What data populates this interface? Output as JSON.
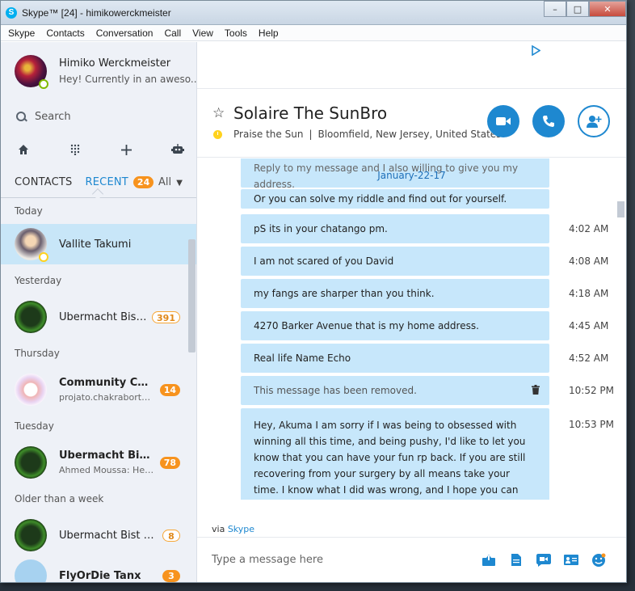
{
  "window": {
    "title": "Skype™ [24] - himikowerckmeister",
    "app_logo": "S",
    "buttons": {
      "minimize": "–",
      "maximize": "□",
      "close": "✕"
    }
  },
  "menu": [
    "Skype",
    "Contacts",
    "Conversation",
    "Call",
    "View",
    "Tools",
    "Help"
  ],
  "profile": {
    "name": "Himiko Werckmeister",
    "mood": "Hey! Currently in an aweso..."
  },
  "search": {
    "placeholder": "Search"
  },
  "toolbar_icons": [
    "home-icon",
    "dialpad-icon",
    "plus-icon",
    "bot-icon"
  ],
  "tabs": {
    "contacts": "CONTACTS",
    "recent": "RECENT",
    "recent_count": "24",
    "filter": "All"
  },
  "sections": [
    {
      "header": "Today",
      "items": [
        {
          "name": "Vallite Takumi",
          "preview": "",
          "badge": "",
          "bold": false,
          "selected": true,
          "avatar": "anime",
          "status": "away"
        }
      ]
    },
    {
      "header": "Yesterday",
      "items": [
        {
          "name": "Übermacht Bist R...",
          "preview": "",
          "badge": "391",
          "badge_style": "outline",
          "bold": false,
          "avatar": "eagle"
        }
      ]
    },
    {
      "header": "Thursday",
      "items": [
        {
          "name": "Community Chat...",
          "preview": "projato.chakraborty:...",
          "badge": "14",
          "bold": true,
          "avatar": "community"
        }
      ]
    },
    {
      "header": "Tuesday",
      "items": [
        {
          "name": "Übermacht Bist...",
          "preview": "Ahmed Moussa: Hel...",
          "badge": "78",
          "bold": true,
          "avatar": "eagle"
        }
      ]
    },
    {
      "header": "Older than a week",
      "items": [
        {
          "name": "Übermacht Bist Rein",
          "preview": "",
          "badge": "8",
          "badge_style": "outline",
          "bold": false,
          "avatar": "eagle"
        },
        {
          "name": "FlyOrDie Tanx",
          "preview": "",
          "badge": "3",
          "bold": true,
          "avatar": "group"
        }
      ]
    }
  ],
  "conversation": {
    "contact_name": "Solaire The SunBro",
    "mood": "Praise the Sun",
    "location": "Bloomfield, New Jersey, United States",
    "date_chip": "January-22-17",
    "faded_text": "Reply to my message and I also willing to give you my address.",
    "messages": [
      {
        "text": "Or you can solve my riddle and find out for yourself.",
        "time": ""
      },
      {
        "text": "pS its in your chatango pm.",
        "time": "4:02 AM"
      },
      {
        "text": "I am not scared of you David",
        "time": "4:08 AM"
      },
      {
        "text": "my fangs are sharper than you think.",
        "time": "4:18 AM"
      },
      {
        "text": "4270 Barker Avenue that is my home address.",
        "time": "4:45 AM"
      },
      {
        "text": "Real life Name Echo",
        "time": "4:52 AM"
      },
      {
        "text": "This message has been removed.",
        "time": "10:52 PM"
      },
      {
        "text": "Hey, Akuma I am sorry if I was being to obsessed with winning all this time, and being pushy, I'd like to let you know that you can have your fun rp back. If you are still recovering from your surgery by all means take your time. I know what I did was wrong, and I hope you can",
        "time": "10:53 PM"
      }
    ],
    "via_prefix": "via",
    "via_link": "Skype",
    "compose_placeholder": "Type a message here"
  },
  "colors": {
    "accent": "#1e88d0",
    "bubble": "#c7e7fb",
    "selected": "#c8e6f8",
    "badge": "#f7931e",
    "sidebar": "#eef1f7"
  }
}
